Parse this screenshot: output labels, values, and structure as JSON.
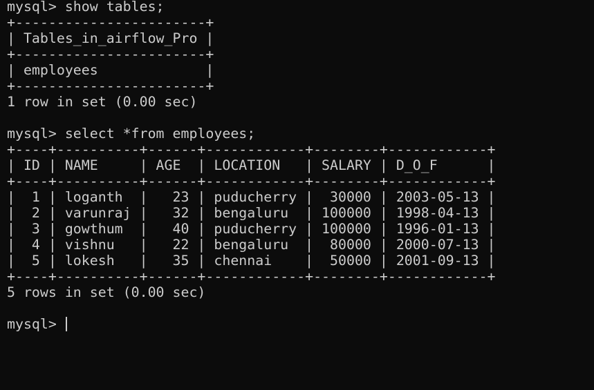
{
  "colors": {
    "background": "#0c0c0c",
    "text": "#cccccc"
  },
  "lines": [
    "mysql> show tables;",
    "+-----------------------+",
    "| Tables_in_airflow_Pro |",
    "+-----------------------+",
    "| employees             |",
    "+-----------------------+",
    "1 row in set (0.00 sec)",
    "",
    "mysql> select *from employees;",
    "+----+----------+------+------------+--------+------------+",
    "| ID | NAME     | AGE  | LOCATION   | SALARY | D_O_F      |",
    "+----+----------+------+------------+--------+------------+",
    "|  1 | loganth  |   23 | puducherry |  30000 | 2003-05-13 |",
    "|  2 | varunraj |   32 | bengaluru  | 100000 | 1998-04-13 |",
    "|  3 | gowthum  |   40 | puducherry | 100000 | 1996-01-13 |",
    "|  4 | vishnu   |   22 | bengaluru  |  80000 | 2000-07-13 |",
    "|  5 | lokesh   |   35 | chennai    |  50000 | 2001-09-13 |",
    "+----+----------+------+------------+--------+------------+",
    "5 rows in set (0.00 sec)",
    ""
  ],
  "prompt": "mysql> "
}
